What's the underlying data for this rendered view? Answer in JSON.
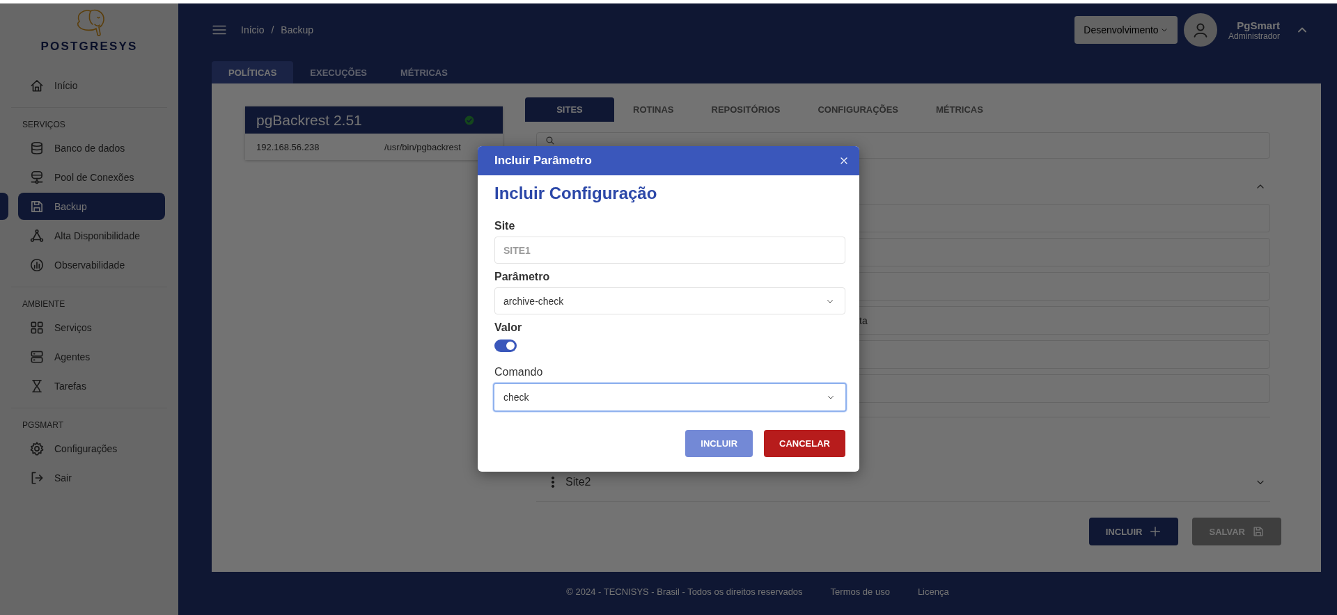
{
  "sidebar": {
    "logo": "POSTGRESYS",
    "sections": [
      {
        "items": [
          {
            "label": "Início",
            "selected": false
          }
        ]
      },
      {
        "heading": "SERVIÇOS",
        "items": [
          {
            "label": "Banco de dados",
            "selected": false
          },
          {
            "label": "Pool de Conexões",
            "selected": false
          },
          {
            "label": "Backup",
            "selected": true
          },
          {
            "label": "Alta Disponibilidade",
            "selected": false
          },
          {
            "label": "Observabilidade",
            "selected": false
          }
        ]
      },
      {
        "heading": "AMBIENTE",
        "items": [
          {
            "label": "Serviços",
            "selected": false
          },
          {
            "label": "Agentes",
            "selected": false
          },
          {
            "label": "Tarefas",
            "selected": false
          }
        ]
      },
      {
        "heading": "PGSMART",
        "items": [
          {
            "label": "Configurações",
            "selected": false
          },
          {
            "label": "Sair",
            "selected": false
          }
        ]
      }
    ]
  },
  "header": {
    "breadcrumb": [
      "Início",
      "Backup"
    ],
    "separator": "/",
    "environment": "Desenvolvimento",
    "user": {
      "name": "PgSmart",
      "role": "Administrador"
    }
  },
  "page_tabs": [
    {
      "label": "POLÍTICAS",
      "selected": true
    },
    {
      "label": "EXECUÇÕES",
      "selected": false
    },
    {
      "label": "MÉTRICAS",
      "selected": false
    }
  ],
  "server_card": {
    "title": "pgBackrest 2.51",
    "host": "192.168.56.238",
    "path": "/usr/bin/pgbackrest"
  },
  "site_tabs": [
    {
      "label": "SITES",
      "selected": true
    },
    {
      "label": "ROTINAS",
      "selected": false
    },
    {
      "label": "REPOSITÓRIOS",
      "selected": false
    },
    {
      "label": "CONFIGURAÇÕES",
      "selected": false
    },
    {
      "label": "MÉTRICAS",
      "selected": false
    }
  ],
  "sites": [
    {
      "expanded": true,
      "fields": [
        {
          "kind": "blank"
        },
        {
          "kind": "blank"
        },
        {
          "kind": "blank"
        },
        {
          "kind": "text",
          "text": "ta"
        },
        {
          "kind": "blank"
        },
        {
          "kind": "blank"
        }
      ]
    },
    {
      "name": "Site2",
      "expanded": false
    }
  ],
  "actions": [
    {
      "label": "INCLUIR",
      "kind": "add",
      "disabled": false
    },
    {
      "label": "SALVAR",
      "kind": "save",
      "disabled": true
    }
  ],
  "footer": {
    "copyright": "© 2024 - TECNISYS - Brasil - Todos os direitos reservados",
    "links": [
      "Termos de uso",
      "Licença"
    ]
  },
  "dialog": {
    "title": "Incluir Parâmetro",
    "heading": "Incluir Configuração",
    "fields": [
      {
        "kind": "text",
        "label": "Site",
        "bold_label": true,
        "value": "SITE1",
        "disabled": true
      },
      {
        "kind": "select",
        "label": "Parâmetro",
        "bold_label": true,
        "value": "archive-check",
        "focused": false
      },
      {
        "kind": "toggle",
        "label": "Valor",
        "bold_label": true,
        "on": true
      },
      {
        "kind": "select",
        "label": "Comando",
        "bold_label": false,
        "value": "check",
        "focused": true
      }
    ],
    "buttons": [
      {
        "label": "INCLUIR",
        "kind": "primary",
        "disabled": true
      },
      {
        "label": "CANCELAR",
        "kind": "danger",
        "disabled": false
      }
    ]
  }
}
